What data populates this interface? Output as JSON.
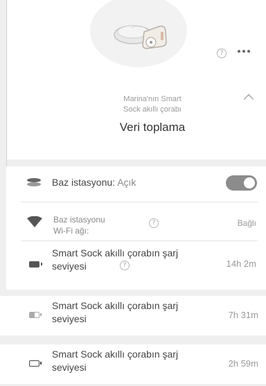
{
  "header": {
    "subtitle_line1": "Marina'nın Smart",
    "subtitle_line2": "Sock akıllı çorabı",
    "title": "Veri toplama"
  },
  "icons": {
    "help": "?",
    "device": "base-station-device-icon"
  },
  "rows": {
    "base_station": {
      "label": "Baz istasyonu:",
      "status": "Açık",
      "toggle_on": true
    },
    "wifi": {
      "label_line1": "Baz istasyonu",
      "label_line2": "Wi-Fi ağı:",
      "value": "Bağlı"
    },
    "charge1": {
      "label_line1": "Smart Sock akıllı çorabın şarj",
      "label_line2": "seviyesi",
      "value": "14h 2m",
      "battery_level": 1.0
    },
    "charge2": {
      "label_line1": "Smart Sock akıllı çorabın şarj",
      "label_line2": "seviyesi",
      "value": "7h 31m",
      "battery_level": 0.5
    },
    "charge3": {
      "label_line1": "Smart Sock akıllı çorabın şarj",
      "label_line2": "seviyesi",
      "value": "2h 59m",
      "battery_level": 0.05
    }
  }
}
